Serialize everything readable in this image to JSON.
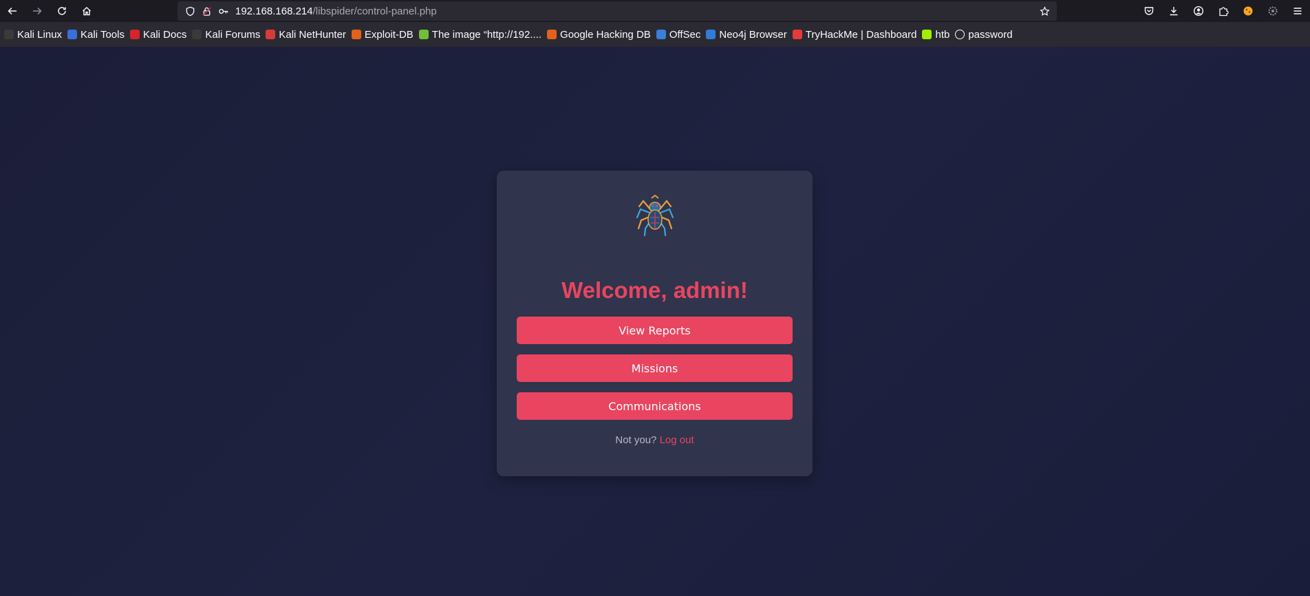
{
  "browser": {
    "url_host": "192.168.168.214",
    "url_path": "/libspider/control-panel.php"
  },
  "bookmarks": [
    {
      "label": "Kali Linux",
      "icon": "kali-dragon-icon",
      "color": "#3a3a3a"
    },
    {
      "label": "Kali Tools",
      "icon": "kali-tools-icon",
      "color": "#3a6fd8"
    },
    {
      "label": "Kali Docs",
      "icon": "kali-docs-icon",
      "color": "#d8232a"
    },
    {
      "label": "Kali Forums",
      "icon": "kali-dragon-icon",
      "color": "#3a3a3a"
    },
    {
      "label": "Kali NetHunter",
      "icon": "nethunter-icon",
      "color": "#d83a3a"
    },
    {
      "label": "Exploit-DB",
      "icon": "exploit-db-icon",
      "color": "#e2621c"
    },
    {
      "label": "The image “http://192....",
      "icon": "image-icon",
      "color": "#6fbf3a"
    },
    {
      "label": "Google Hacking DB",
      "icon": "ghdb-icon",
      "color": "#e2621c"
    },
    {
      "label": "OffSec",
      "icon": "offsec-icon",
      "color": "#3a7fd8"
    },
    {
      "label": "Neo4j Browser",
      "icon": "neo4j-icon",
      "color": "#2f7dd8"
    },
    {
      "label": "TryHackMe | Dashboard",
      "icon": "tryhackme-icon",
      "color": "#e33b3b"
    },
    {
      "label": "htb",
      "icon": "htb-cube-icon",
      "color": "#9fef00"
    },
    {
      "label": "password",
      "icon": "globe-icon",
      "color": "#fbfbfe"
    }
  ],
  "panel": {
    "welcome": "Welcome, admin!",
    "buttons": {
      "reports": "View Reports",
      "missions": "Missions",
      "communications": "Communications"
    },
    "not_you": "Not you?",
    "logout": "Log out"
  },
  "colors": {
    "accent": "#e94560",
    "card": "#30344d",
    "background": "#1c1f3a"
  }
}
